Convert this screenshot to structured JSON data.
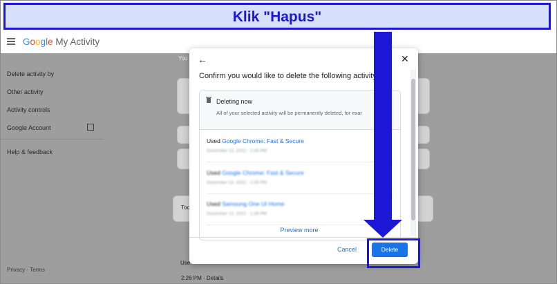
{
  "banner": {
    "text": "Klik \"Hapus\""
  },
  "app": {
    "brand": {
      "g": "G",
      "o1": "o",
      "o2": "o",
      "g2": "g",
      "l": "l",
      "e": "e",
      "rest": " My Activity"
    },
    "sidebar": {
      "items": [
        {
          "label": "Delete activity by"
        },
        {
          "label": "Other activity"
        },
        {
          "label": "Activity controls"
        },
        {
          "label": "Google Account"
        },
        {
          "label": "Help & feedback"
        }
      ],
      "footer": "Privacy · Terms"
    },
    "background": {
      "you_label": "You",
      "today_label": "Too",
      "time_details": "2:26 PM · Details",
      "used_label": "Use"
    }
  },
  "dialog": {
    "title": "Confirm you would like to delete the following activity",
    "deleting": {
      "title": "Deleting now",
      "subtitle": "All of your selected activity will be permanently deleted, for exar"
    },
    "entries": [
      {
        "prefix": "Used ",
        "app": "Google Chrome: Fast & Secure",
        "date": "December 13, 2022 · 2:26 PM"
      },
      {
        "prefix": "Used ",
        "app": "Google Chrome: Fast & Secure",
        "date": "December 13, 2022 · 1:39 PM"
      },
      {
        "prefix": "Used ",
        "app": "Samsung One UI Home",
        "date": "December 13, 2022 · 1:39 PM"
      }
    ],
    "preview_more": "Preview more",
    "cancel": "Cancel",
    "delete": "Delete"
  },
  "colors": {
    "accent": "#1a73e8",
    "annotation": "#1b17d4"
  }
}
